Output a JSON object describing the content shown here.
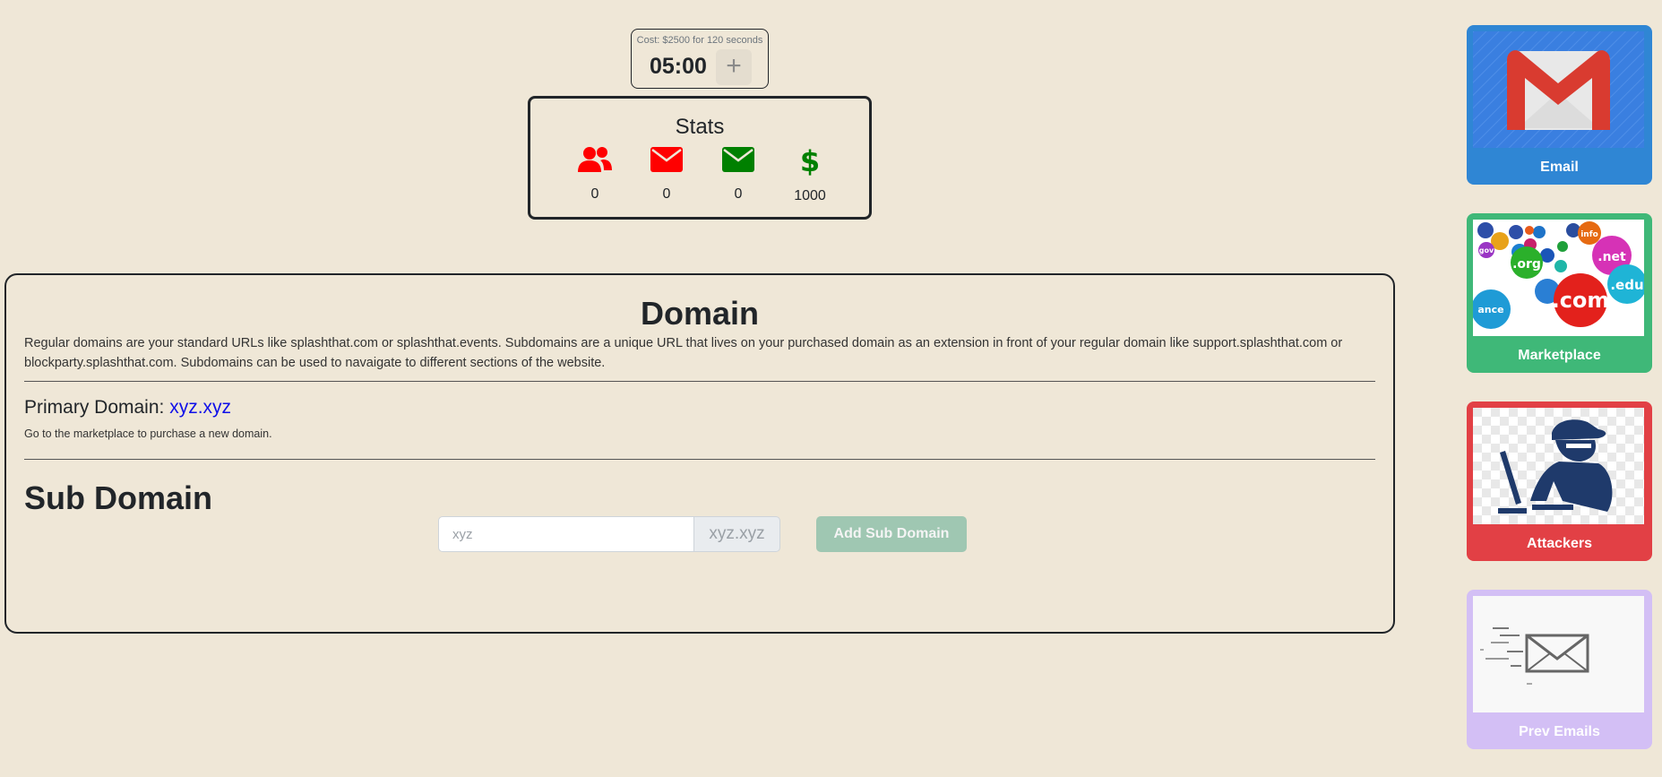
{
  "timer": {
    "cost": "Cost: $2500 for 120 seconds",
    "time": "05:00",
    "add_label": "+"
  },
  "stats": {
    "title": "Stats",
    "items": [
      {
        "icon": "users-icon",
        "color": "#ff0000",
        "value": "0"
      },
      {
        "icon": "mail-icon",
        "color": "#ff0000",
        "value": "0"
      },
      {
        "icon": "mail-icon",
        "color": "#008000",
        "value": "0"
      },
      {
        "icon": "dollar-icon",
        "color": "#008000",
        "value": "1000"
      }
    ]
  },
  "domain": {
    "title": "Domain",
    "description": "Regular domains are your standard URLs like splashthat.com or splashthat.events. Subdomains are a unique URL that lives on your purchased domain as an extension in front of your regular domain like support.splashthat.com or blockparty.splashthat.com. Subdomains can be used to navaigate to different sections of the website.",
    "primary_label": "Primary Domain: ",
    "primary_value": "xyz.xyz",
    "note": "Go to the marketplace to purchase a new domain.",
    "sub_title": "Sub Domain",
    "sub_placeholder": "xyz",
    "sub_suffix": "xyz.xyz",
    "add_button": "Add Sub Domain"
  },
  "sidebar": {
    "cards": [
      {
        "label": "Email",
        "color": "#2f86d4"
      },
      {
        "label": "Marketplace",
        "color": "#3fb878"
      },
      {
        "label": "Attackers",
        "color": "#e24045"
      },
      {
        "label": "Prev Emails",
        "color": "#d3bff5"
      }
    ],
    "domain_bubbles": [
      ".org",
      ".com",
      ".net",
      ".edu",
      "info",
      "gov",
      "ance"
    ]
  }
}
